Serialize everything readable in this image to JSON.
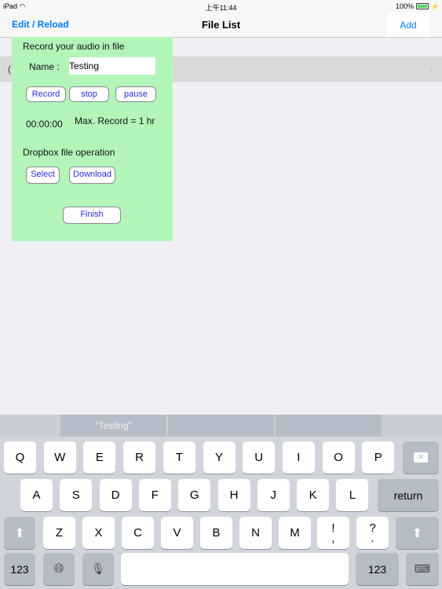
{
  "status_bar": {
    "device": "iPad",
    "wifi_icon": "wifi-icon",
    "time": "上午11:44",
    "battery_percent": "100%",
    "battery_icon": "battery-icon",
    "charging_icon": "bolt-icon"
  },
  "nav": {
    "left_label": "Edit / Reload",
    "title": "File List",
    "right_label": "Add"
  },
  "list": {
    "rows": [
      {
        "text": "(",
        "chevron": "chevron-right-icon"
      }
    ]
  },
  "panel": {
    "record_heading": "Record your audio in file",
    "name_label": "Name :",
    "name_value": "Testing",
    "record_button": "Record",
    "stop_button": "stop",
    "pause_button": "pause",
    "timer": "00:00:00",
    "max_record": "Max. Record = 1 hr",
    "dropbox_heading": "Dropbox file operation",
    "select_button": "Select",
    "download_button": "Download",
    "finish_button": "Finish"
  },
  "keyboard": {
    "suggestions": [
      "“Testing”",
      "",
      ""
    ],
    "row1": [
      "Q",
      "W",
      "E",
      "R",
      "T",
      "Y",
      "U",
      "I",
      "O",
      "P"
    ],
    "row2": [
      "A",
      "S",
      "D",
      "F",
      "G",
      "H",
      "J",
      "K",
      "L"
    ],
    "row3": [
      "Z",
      "X",
      "C",
      "V",
      "B",
      "N",
      "M"
    ],
    "punct1_top": "!",
    "punct1_bottom": ",",
    "punct2_top": "?",
    "punct2_bottom": ".",
    "return_label": "return",
    "numbers_label": "123",
    "numbers_label_right": "123"
  }
}
